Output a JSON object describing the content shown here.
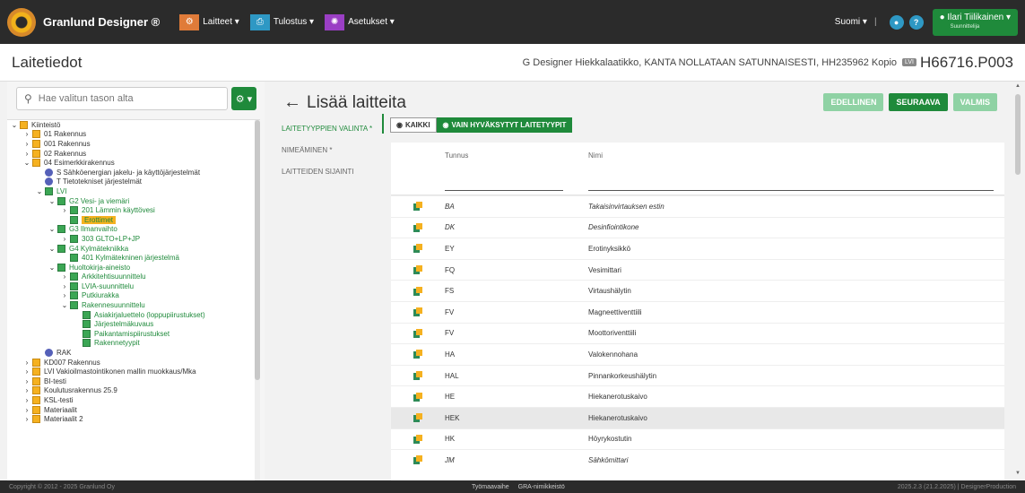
{
  "topbar": {
    "brand": "Granlund Designer ®",
    "menus": [
      {
        "label": "Laitteet ▾",
        "color": "#e07b39"
      },
      {
        "label": "Tulostus ▾",
        "color": "#2e98c4"
      },
      {
        "label": "Asetukset ▾",
        "color": "#9a3fc4"
      }
    ],
    "language": "Suomi ▾",
    "separator": "|",
    "user_name": "Ilari Tiilikainen ▾",
    "user_role": "Suunnittelija"
  },
  "header": {
    "title": "Laitetiedot",
    "project_text": "G Designer Hiekkalaatikko, KANTA NOLLATAAN SATUNNAISESTI, HH235962 Kopio",
    "project_badge": "LVI",
    "project_code": "H66716.P003"
  },
  "search": {
    "placeholder": "Hae valitun tason alta"
  },
  "tree": [
    {
      "label": "Kiinteistö",
      "depth": 0,
      "chev": "open",
      "icon": "folder",
      "style": ""
    },
    {
      "label": "01 Rakennus",
      "depth": 1,
      "chev": "closed",
      "icon": "folder",
      "style": ""
    },
    {
      "label": "001 Rakennus",
      "depth": 1,
      "chev": "closed",
      "icon": "folder",
      "style": ""
    },
    {
      "label": "02 Rakennus",
      "depth": 1,
      "chev": "closed",
      "icon": "folder",
      "style": ""
    },
    {
      "label": "04 Esimerkkirakennus",
      "depth": 1,
      "chev": "open",
      "icon": "folder",
      "style": ""
    },
    {
      "label": "S Sähköenergian jakelu- ja käyttöjärjestelmät",
      "depth": 2,
      "chev": "none",
      "icon": "circle",
      "style": ""
    },
    {
      "label": "T Tietotekniset järjestelmät",
      "depth": 2,
      "chev": "none",
      "icon": "circle",
      "style": ""
    },
    {
      "label": "LVI",
      "depth": 2,
      "chev": "open",
      "icon": "green",
      "style": "green"
    },
    {
      "label": "G2 Vesi- ja viemäri",
      "depth": 3,
      "chev": "open",
      "icon": "green",
      "style": "green"
    },
    {
      "label": "201 Lämmin käyttövesi",
      "depth": 4,
      "chev": "closed",
      "icon": "green",
      "style": "green"
    },
    {
      "label": "Erottimet",
      "depth": 4,
      "chev": "none",
      "icon": "green",
      "style": "selected"
    },
    {
      "label": "G3 Ilmanvaihto",
      "depth": 3,
      "chev": "open",
      "icon": "green",
      "style": "green"
    },
    {
      "label": "303 GLTO+LP+JP",
      "depth": 4,
      "chev": "closed",
      "icon": "green",
      "style": "green"
    },
    {
      "label": "G4 Kylmätekniikka",
      "depth": 3,
      "chev": "open",
      "icon": "green",
      "style": "green"
    },
    {
      "label": "401 Kylmätekninen järjestelmä",
      "depth": 4,
      "chev": "none",
      "icon": "green",
      "style": "green"
    },
    {
      "label": "Huoltokirja-aineisto",
      "depth": 3,
      "chev": "open",
      "icon": "green",
      "style": "green"
    },
    {
      "label": "Arkkitehtisuunnittelu",
      "depth": 4,
      "chev": "closed",
      "icon": "green",
      "style": "green"
    },
    {
      "label": "LVIA-suunnittelu",
      "depth": 4,
      "chev": "closed",
      "icon": "green",
      "style": "green"
    },
    {
      "label": "Putkiurakka",
      "depth": 4,
      "chev": "closed",
      "icon": "green",
      "style": "green"
    },
    {
      "label": "Rakennesuunnittelu",
      "depth": 4,
      "chev": "open",
      "icon": "green",
      "style": "green"
    },
    {
      "label": "Asiakirjaluettelo (loppupiirustukset)",
      "depth": 5,
      "chev": "none",
      "icon": "green",
      "style": "green"
    },
    {
      "label": "Järjestelmäkuvaus",
      "depth": 5,
      "chev": "none",
      "icon": "green",
      "style": "green"
    },
    {
      "label": "Paikantamispiirustukset",
      "depth": 5,
      "chev": "none",
      "icon": "green",
      "style": "green"
    },
    {
      "label": "Rakennetyypit",
      "depth": 5,
      "chev": "none",
      "icon": "green",
      "style": "green"
    },
    {
      "label": "RAK",
      "depth": 2,
      "chev": "none",
      "icon": "circle",
      "style": ""
    },
    {
      "label": "KD007 Rakennus",
      "depth": 1,
      "chev": "closed",
      "icon": "folder",
      "style": ""
    },
    {
      "label": "LVI Vakioilmastointikonen mallin muokkaus/Mka",
      "depth": 1,
      "chev": "closed",
      "icon": "folder",
      "style": ""
    },
    {
      "label": "BI-testi",
      "depth": 1,
      "chev": "closed",
      "icon": "folder",
      "style": ""
    },
    {
      "label": "Koulutusrakennus 25.9",
      "depth": 1,
      "chev": "closed",
      "icon": "folder",
      "style": ""
    },
    {
      "label": "KSL-testi",
      "depth": 1,
      "chev": "closed",
      "icon": "folder",
      "style": ""
    },
    {
      "label": "Materiaalit",
      "depth": 1,
      "chev": "closed",
      "icon": "folder",
      "style": ""
    },
    {
      "label": "Materiaalit 2",
      "depth": 1,
      "chev": "closed",
      "icon": "folder",
      "style": ""
    }
  ],
  "main": {
    "title": "Lisää laitteita",
    "buttons": {
      "prev": "EDELLINEN",
      "next": "SEURAAVA",
      "done": "VALMIS"
    },
    "wizard": [
      "LAITETYYPPIEN VALINTA *",
      "NIMEÄMINEN *",
      "LAITTEIDEN SIJAINTI"
    ],
    "filters": {
      "all": "KAIKKI",
      "approved": "VAIN HYVÄKSYTYT LAITETYYPIT"
    }
  },
  "table": {
    "headers": {
      "code": "Tunnus",
      "name": "Nimi"
    },
    "rows": [
      {
        "code": "BA",
        "name": "Takaisinvirtauksen estin",
        "italic": true,
        "hl": false
      },
      {
        "code": "DK",
        "name": "Desinfiointikone",
        "italic": true,
        "hl": false
      },
      {
        "code": "EY",
        "name": "Erotinyksikkö",
        "italic": false,
        "hl": false
      },
      {
        "code": "FQ",
        "name": "Vesimittari",
        "italic": false,
        "hl": false
      },
      {
        "code": "FS",
        "name": "Virtaushälytin",
        "italic": false,
        "hl": false
      },
      {
        "code": "FV",
        "name": "Magneettiventtiili",
        "italic": false,
        "hl": false
      },
      {
        "code": "FV",
        "name": "Moottoriventtiili",
        "italic": false,
        "hl": false
      },
      {
        "code": "HA",
        "name": "Valokennohana",
        "italic": false,
        "hl": false
      },
      {
        "code": "HAL",
        "name": "Pinnankorkeushälytin",
        "italic": false,
        "hl": false
      },
      {
        "code": "HE",
        "name": "Hiekanerotuskaivo",
        "italic": false,
        "hl": false
      },
      {
        "code": "HEK",
        "name": "Hiekanerotuskaivo",
        "italic": false,
        "hl": true
      },
      {
        "code": "HK",
        "name": "Höyrykostutin",
        "italic": false,
        "hl": false
      },
      {
        "code": "JM",
        "name": "Sähkömittari",
        "italic": true,
        "hl": false
      }
    ]
  },
  "footer": {
    "copyright": "Copyright © 2012 - 2025 Granlund Oy",
    "mid1": "Työmaavaihe",
    "mid2": "GRA-nimikkeistö",
    "version": "2025.2.3 (21.2.2025) | DesignerProduction"
  }
}
